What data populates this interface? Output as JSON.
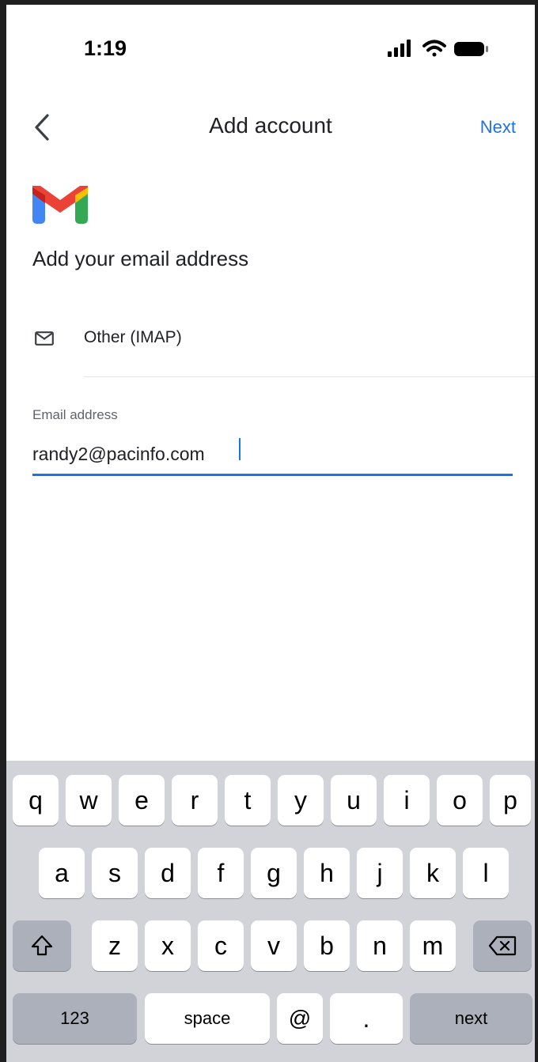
{
  "status_bar": {
    "time": "1:19"
  },
  "nav": {
    "title": "Add account",
    "next_label": "Next"
  },
  "content": {
    "heading": "Add your email address",
    "provider": {
      "label": "Other (IMAP)",
      "icon": "envelope-icon"
    },
    "email_field": {
      "label": "Email address",
      "value": "randy2@pacinfo.com"
    }
  },
  "colors": {
    "accent": "#1a73e8",
    "keyboard_bg": "#d1d3d9",
    "special_key": "#abb0ba"
  },
  "keyboard": {
    "row1": [
      "q",
      "w",
      "e",
      "r",
      "t",
      "y",
      "u",
      "i",
      "o",
      "p"
    ],
    "row2": [
      "a",
      "s",
      "d",
      "f",
      "g",
      "h",
      "j",
      "k",
      "l"
    ],
    "row3": [
      "z",
      "x",
      "c",
      "v",
      "b",
      "n",
      "m"
    ],
    "numbers_label": "123",
    "space_label": "space",
    "at_label": "@",
    "period_label": ".",
    "return_label": "next"
  }
}
